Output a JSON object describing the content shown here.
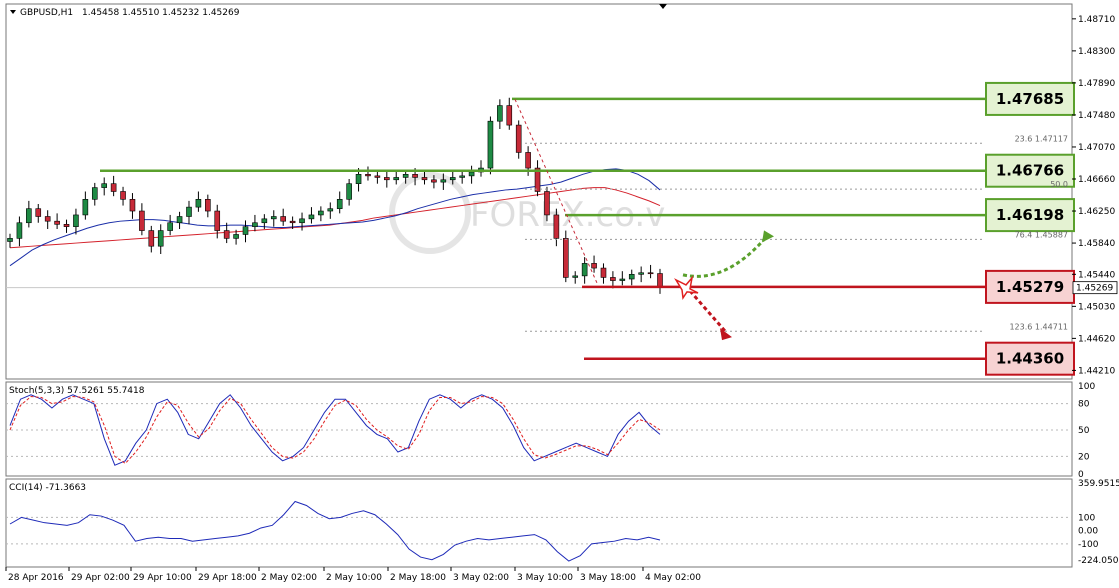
{
  "header": {
    "symbol": "GBPUSD,H1",
    "ohlc": "1.45458 1.45510 1.45232 1.45269"
  },
  "watermark": "FOREX.co.v",
  "colors": {
    "bull": "#1e8a44",
    "bear": "#c72a38",
    "ma_blue": "#1a2ea8",
    "ma_red": "#d4212b",
    "support": "#c0141e",
    "resistance": "#5aa02c"
  },
  "chart_data": [
    {
      "type": "candlestick",
      "panel": "price",
      "symbol": "GBPUSD",
      "timeframe": "H1",
      "last_price": "1.45269",
      "ylim": [
        1.441,
        1.489
      ],
      "y_ticks": [
        "1.48710",
        "1.48300",
        "1.47890",
        "1.47480",
        "1.47070",
        "1.46660",
        "1.46250",
        "1.45840",
        "1.45440",
        "1.45030",
        "1.44620",
        "1.44210"
      ],
      "x_ticks": [
        "28 Apr 2016",
        "29 Apr 02:00",
        "29 Apr 10:00",
        "29 Apr 18:00",
        "2 May 02:00",
        "2 May 10:00",
        "2 May 18:00",
        "3 May 02:00",
        "3 May 10:00",
        "3 May 18:00",
        "4 May 02:00"
      ],
      "close": [
        1.459,
        1.461,
        1.4628,
        1.4618,
        1.4612,
        1.4608,
        1.4605,
        1.462,
        1.464,
        1.4655,
        1.466,
        1.465,
        1.464,
        1.4625,
        1.46,
        1.458,
        1.46,
        1.461,
        1.4618,
        1.463,
        1.464,
        1.4625,
        1.46,
        1.459,
        1.4595,
        1.4605,
        1.461,
        1.4615,
        1.4618,
        1.4612,
        1.461,
        1.4615,
        1.462,
        1.4625,
        1.4628,
        1.464,
        1.466,
        1.4672,
        1.467,
        1.4668,
        1.4665,
        1.4668,
        1.4672,
        1.4668,
        1.4665,
        1.4662,
        1.4665,
        1.4668,
        1.467,
        1.4675,
        1.468,
        1.474,
        1.476,
        1.4735,
        1.47,
        1.468,
        1.465,
        1.462,
        1.459,
        1.454,
        1.4542,
        1.4558,
        1.4552,
        1.454,
        1.4536,
        1.4538,
        1.4544,
        1.4546,
        1.4545,
        1.4527
      ],
      "sma_blue": [
        1.4555,
        1.4565,
        1.4575,
        1.4582,
        1.4588,
        1.4593,
        1.4598,
        1.4603,
        1.4607,
        1.461,
        1.4612,
        1.4613,
        1.4614,
        1.4614,
        1.4613,
        1.4611,
        1.4609,
        1.4607,
        1.4606,
        1.4606,
        1.4607,
        1.4607,
        1.4606,
        1.4605,
        1.4604,
        1.4604,
        1.4605,
        1.4606,
        1.4607,
        1.4608,
        1.4609,
        1.461,
        1.4611,
        1.4613,
        1.4616,
        1.4619,
        1.4623,
        1.4628,
        1.4632,
        1.4636,
        1.464,
        1.4643,
        1.4646,
        1.4648,
        1.465,
        1.4652,
        1.4653,
        1.4655,
        1.4657,
        1.4659,
        1.4662,
        1.4667,
        1.4672,
        1.4676,
        1.4678,
        1.4679,
        1.4677,
        1.4672,
        1.4664,
        1.4652
      ],
      "sma_red": [
        1.4578,
        1.4579,
        1.458,
        1.4581,
        1.4582,
        1.4583,
        1.4584,
        1.4585,
        1.4586,
        1.4587,
        1.4588,
        1.4589,
        1.459,
        1.4591,
        1.4592,
        1.4593,
        1.4594,
        1.4595,
        1.4596,
        1.4597,
        1.4598,
        1.4599,
        1.46,
        1.4601,
        1.4602,
        1.4603,
        1.4604,
        1.4605,
        1.4606,
        1.4607,
        1.4609,
        1.4611,
        1.4613,
        1.4616,
        1.4618,
        1.462,
        1.4622,
        1.4624,
        1.4626,
        1.4628,
        1.463,
        1.4632,
        1.4634,
        1.4636,
        1.4638,
        1.464,
        1.4642,
        1.4644,
        1.4646,
        1.4648,
        1.465,
        1.4652,
        1.4654,
        1.4655,
        1.4655,
        1.4652,
        1.4648,
        1.4643,
        1.4638,
        1.4632
      ],
      "levels": [
        {
          "value": 1.47685,
          "label": "1.47685",
          "kind": "resistance"
        },
        {
          "value": 1.46766,
          "label": "1.46766",
          "kind": "resistance"
        },
        {
          "value": 1.46198,
          "label": "1.46198",
          "kind": "resistance"
        },
        {
          "value": 1.45279,
          "label": "1.45279",
          "kind": "support"
        },
        {
          "value": 1.4436,
          "label": "1.44360",
          "kind": "support"
        }
      ],
      "fib_labels": [
        {
          "value": 1.47117,
          "label": "23.6  1.47117"
        },
        {
          "value": 1.4653,
          "label": "50.0"
        },
        {
          "value": 1.45887,
          "label": "76.4  1.45887"
        },
        {
          "value": 1.44711,
          "label": "123.6  1.44711"
        }
      ]
    },
    {
      "type": "line",
      "panel": "stochastic",
      "title": "Stoch(5,3,3) 57.5261 55.7418",
      "ylim": [
        0,
        100
      ],
      "y_ticks": [
        "100",
        "80",
        "50",
        "20",
        "0"
      ],
      "main": [
        55,
        85,
        90,
        85,
        75,
        85,
        90,
        85,
        80,
        40,
        10,
        15,
        35,
        50,
        80,
        85,
        70,
        45,
        40,
        60,
        80,
        90,
        75,
        55,
        40,
        25,
        15,
        20,
        30,
        50,
        70,
        85,
        85,
        70,
        55,
        45,
        40,
        25,
        30,
        60,
        85,
        90,
        85,
        75,
        85,
        90,
        85,
        75,
        55,
        30,
        15,
        20,
        25,
        30,
        35,
        30,
        25,
        20,
        45,
        60,
        70,
        55,
        45
      ],
      "signal": [
        50,
        78,
        88,
        87,
        80,
        82,
        88,
        87,
        82,
        55,
        20,
        12,
        25,
        42,
        65,
        82,
        78,
        58,
        42,
        52,
        72,
        86,
        80,
        62,
        46,
        30,
        20,
        18,
        25,
        40,
        60,
        78,
        84,
        78,
        62,
        50,
        42,
        32,
        28,
        45,
        72,
        87,
        87,
        80,
        82,
        88,
        87,
        80,
        62,
        40,
        22,
        18,
        22,
        27,
        32,
        32,
        28,
        22,
        35,
        50,
        62,
        58,
        50
      ]
    },
    {
      "type": "line",
      "panel": "cci",
      "title": "CCI(14) -71.3663",
      "ylim": [
        -260,
        360
      ],
      "y_ticks": [
        "359.9515",
        "100",
        "0.00",
        "-100",
        "-224.0502"
      ],
      "values": [
        50,
        100,
        80,
        60,
        50,
        40,
        60,
        120,
        110,
        80,
        40,
        -80,
        -60,
        -50,
        -60,
        -60,
        -80,
        -70,
        -60,
        -50,
        -40,
        -20,
        20,
        40,
        120,
        220,
        190,
        130,
        90,
        100,
        130,
        150,
        120,
        50,
        -30,
        -140,
        -200,
        -220,
        -180,
        -110,
        -80,
        -60,
        -70,
        -60,
        -50,
        -40,
        -30,
        -70
      ],
      "tail": [
        -160,
        -230,
        -190,
        -100,
        -90,
        -80,
        -60,
        -70,
        -50,
        -71
      ]
    }
  ]
}
